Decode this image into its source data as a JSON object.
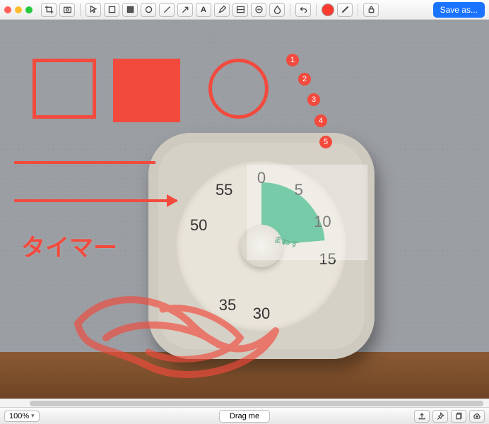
{
  "toolbar": {
    "save_label": "Save as..."
  },
  "annotations": {
    "steps": [
      "1",
      "2",
      "3",
      "4",
      "5"
    ],
    "text_label": "タイマー"
  },
  "timer": {
    "numbers": {
      "0": "0",
      "5": "5",
      "10": "10",
      "15": "15",
      "30": "30",
      "35": "35",
      "50": "50",
      "55": "55"
    },
    "wedge_label": "まわす"
  },
  "bottom": {
    "zoom": "100%",
    "drag_label": "Drag me"
  }
}
